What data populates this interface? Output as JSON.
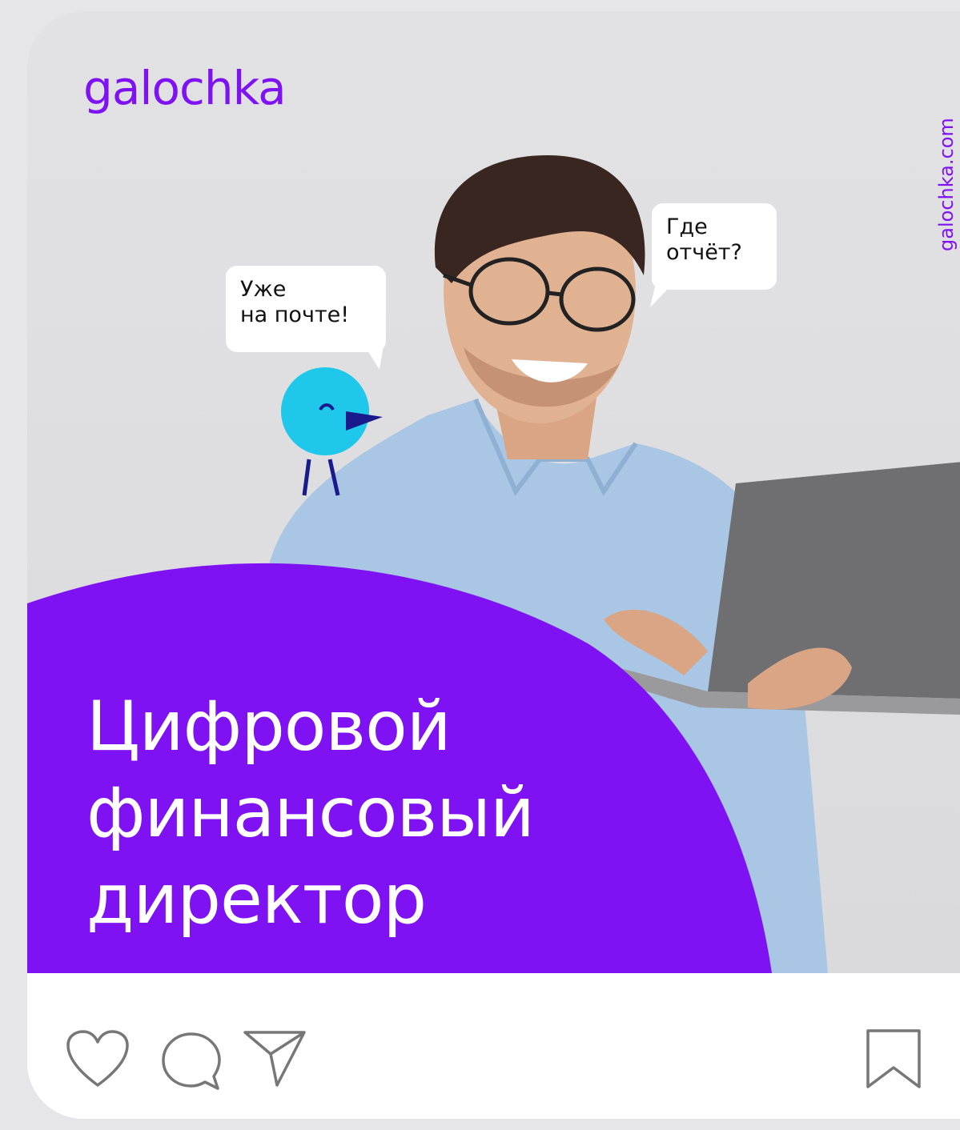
{
  "brand": {
    "logo_text": "galochka",
    "site_url": "galochka.com",
    "accent_color": "#7f12f3",
    "bird_color": "#1fc7ea"
  },
  "bubbles": {
    "bird_lines": [
      "Уже",
      "на почте!"
    ],
    "person_lines": [
      "Где",
      "отчёт?"
    ]
  },
  "headline": {
    "lines": [
      "Цифровой",
      "финансовый",
      "директор"
    ]
  },
  "actions": {
    "left": [
      "heart-icon",
      "comment-icon",
      "share-icon"
    ],
    "right": [
      "bookmark-icon"
    ]
  }
}
